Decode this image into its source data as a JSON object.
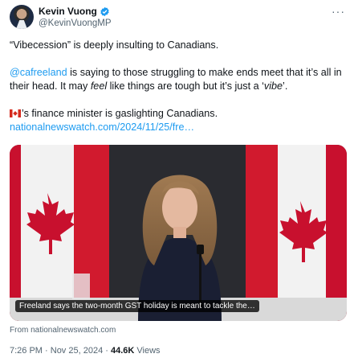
{
  "author": {
    "name": "Kevin Vuong",
    "handle": "@KevinVuongMP"
  },
  "tweet": {
    "line1": "“Vibecession” is deeply insulting to Canadians.",
    "mention": "@cafreeland",
    "line2_a": " is saying to those struggling to make ends meet that it’s all in their head. It may ",
    "line2_em": "feel",
    "line2_b": " like things are tough but it’s just a ‘",
    "line2_vibe": "vibe",
    "line2_c": "’.",
    "line3": "’s finance minister is gaslighting Canadians.",
    "link": "nationalnewswatch.com/2024/11/25/fre…"
  },
  "card": {
    "caption": "Freeland says the two-month GST holiday is meant to tackle the…",
    "source": "From nationalnewswatch.com"
  },
  "meta": {
    "time": "7:26 PM",
    "separator": " · ",
    "date": "Nov 25, 2024",
    "views_count": "44.6K",
    "views_label": "Views"
  },
  "icons": {
    "verified": "verified-badge-icon",
    "more": "more-options-icon",
    "flag": "canada-flag-emoji"
  },
  "colors": {
    "link": "#1d9bf0",
    "secondary_text": "#536471",
    "flag_red": "#d52b1e"
  }
}
